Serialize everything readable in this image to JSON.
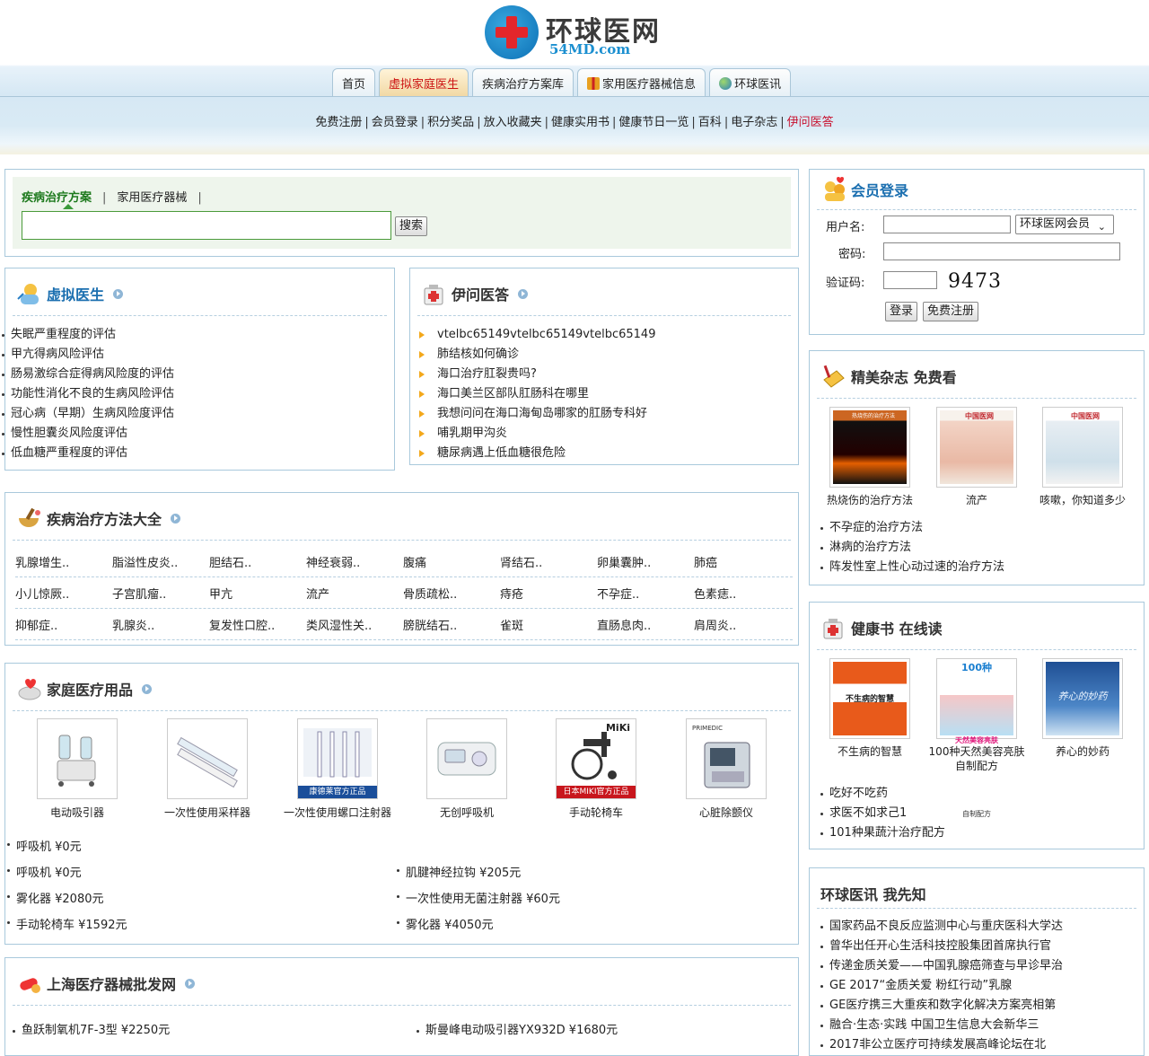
{
  "header": {
    "logo_name": "环球医网",
    "logo_domain": "54MD.com",
    "tabs": [
      {
        "label": "首页"
      },
      {
        "label": "虚拟家庭医生"
      },
      {
        "label": "疾病治疗方案库"
      },
      {
        "label": "家用医疗器械信息"
      },
      {
        "label": "环球医讯"
      }
    ],
    "subnav": [
      "免费注册",
      "会员登录",
      "积分奖品",
      "放入收藏夹",
      "健康实用书",
      "健康节日一览",
      "百科",
      "电子杂志",
      "伊问医答"
    ]
  },
  "search": {
    "tabs": [
      "疾病治疗方案",
      "家用医疗器械"
    ],
    "button": "搜索",
    "value": ""
  },
  "virtual_doctor": {
    "title": "虚拟医生",
    "items": [
      "失眠严重程度的评估",
      "甲亢得病风险评估",
      "肠易激综合症得病风险度的评估",
      "功能性消化不良的生病风险评估",
      "冠心病（早期）生病风险度评估",
      "慢性胆囊炎风险度评估",
      "低血糖严重程度的评估"
    ]
  },
  "qa": {
    "title": "伊问医答",
    "items": [
      "vtelbc65149vtelbc65149vtelbc65149",
      "肺结核如何确诊",
      "海口治疗肛裂贵吗?",
      "海口美兰区部队肛肠科在哪里",
      "我想问问在海口海甸岛哪家的肛肠专科好",
      "哺乳期甲沟炎",
      "糖尿病遇上低血糖很危险"
    ]
  },
  "diseases": {
    "title": "疾病治疗方法大全",
    "rows": [
      [
        "乳腺增生..",
        "脂溢性皮炎..",
        "胆结石..",
        "神经衰弱..",
        "腹痛",
        "肾结石..",
        "卵巢囊肿..",
        "肺癌"
      ],
      [
        "小儿惊厥..",
        "子宫肌瘤..",
        "甲亢",
        "流产",
        "骨质疏松..",
        "痔疮",
        "不孕症..",
        "色素痣.."
      ],
      [
        "抑郁症..",
        "乳腺炎..",
        "复发性口腔..",
        "类风湿性关..",
        "膀胱结石..",
        "雀斑",
        "直肠息肉..",
        "肩周炎.."
      ]
    ]
  },
  "home_supplies": {
    "title": "家庭医疗用品",
    "products": [
      {
        "label": "电动吸引器"
      },
      {
        "label": "一次性使用采样器"
      },
      {
        "label": "一次性使用螺口注射器",
        "banner": "康德莱官方正品"
      },
      {
        "label": "无创呼吸机"
      },
      {
        "label": "手动轮椅车",
        "brand": "MiKi",
        "banner": "日本MIKI官方正品"
      },
      {
        "label": "心脏除颤仪",
        "brand": "PRIMEDIC"
      }
    ],
    "list_left": [
      "呼吸机 ¥0元",
      "呼吸机 ¥0元",
      "雾化器 ¥2080元",
      "手动轮椅车 ¥1592元"
    ],
    "list_right": [
      "肌腱神经拉钩 ¥205元",
      "一次性使用无菌注射器 ¥60元",
      "雾化器 ¥4050元"
    ]
  },
  "shanghai": {
    "title": "上海医疗器械批发网",
    "left": [
      "鱼跃制氧机7F-3型 ¥2250元"
    ],
    "right": [
      "斯曼峰电动吸引器YX932D ¥1680元"
    ]
  },
  "login": {
    "title": "会员登录",
    "username_label": "用户名:",
    "password_label": "密码:",
    "captcha_label": "验证码:",
    "member_type": "环球医网会员",
    "captcha": "9473",
    "login_button": "登录",
    "register_button": "免费注册"
  },
  "magazines": {
    "title": "精美杂志 免费看",
    "items": [
      {
        "label": "热烧伤的治疗方法",
        "cover_text": "热烧伤的治疗方法"
      },
      {
        "label": "流产",
        "cover_text": "中国医网"
      },
      {
        "label": "咳嗽，你知道多少",
        "cover_text": "中国医网"
      }
    ],
    "list": [
      "不孕症的治疗方法",
      "淋病的治疗方法",
      "阵发性室上性心动过速的治疗方法"
    ]
  },
  "books": {
    "title": "健康书 在线读",
    "items": [
      {
        "label": "不生病的智慧",
        "cover_text": "不生病的智慧"
      },
      {
        "label_line1": "100种天然美容亮肤",
        "label_line2": "自制配方",
        "cover_top": "100种",
        "cover_mid": "天然美容亮肤",
        "cover_bot": "自制配方"
      },
      {
        "label": "养心的妙药",
        "cover_text": "养心的妙药"
      }
    ],
    "list": [
      "吃好不吃药",
      "求医不如求己1",
      "101种果蔬汁治疗配方"
    ]
  },
  "news": {
    "title": "环球医讯 我先知",
    "items": [
      "国家药品不良反应监测中心与重庆医科大学达",
      "曾华出任开心生活科技控股集团首席执行官",
      "传递金质关爱——中国乳腺癌筛查与早诊早治",
      "GE 2017“金质关爱 粉红行动”乳腺",
      "GE医疗携三大重疾和数字化解决方案亮相第",
      "融合·生态·实践 中国卫生信息大会新华三",
      "2017非公立医疗可持续发展高峰论坛在北"
    ]
  },
  "colors": {
    "accent": "#1b6fb0",
    "border": "#a9c9dc",
    "green": "#1e7a1e"
  }
}
